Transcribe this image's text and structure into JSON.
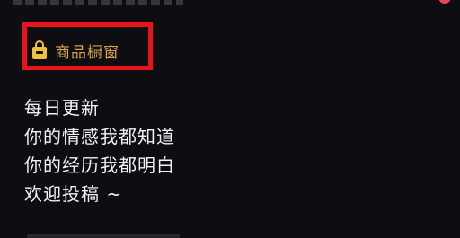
{
  "showcase": {
    "label": "商品橱窗",
    "icon": "shopping-bag-icon",
    "highlight_color": "#e8141b",
    "label_color": "#d7a44a"
  },
  "description": {
    "lines": [
      "每日更新",
      "你的情感我都知道",
      "你的经历我都明白",
      "欢迎投稿 ~"
    ]
  }
}
